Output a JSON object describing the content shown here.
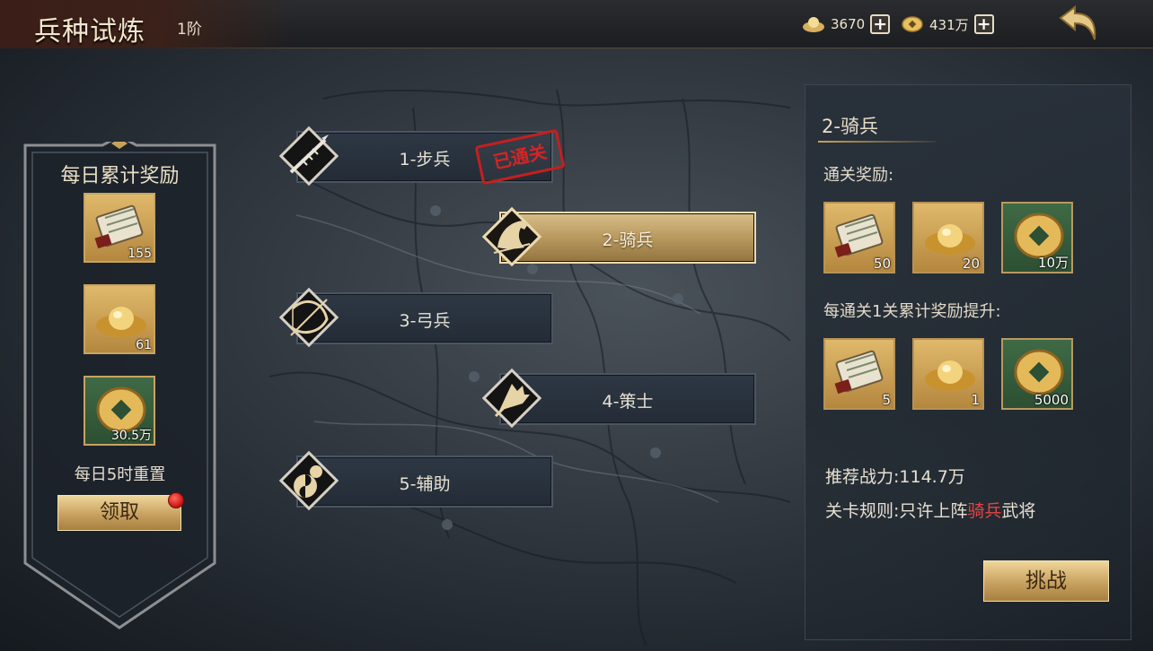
{
  "header": {
    "title": "兵种试炼",
    "rank": "1阶",
    "silver_amount": "3670",
    "gold_amount": "431万",
    "silver_icon": "silver-ingot-icon",
    "gold_icon": "gold-coin-icon",
    "add_label": "+"
  },
  "daily_panel": {
    "title": "每日累计奖励",
    "items": [
      {
        "icon": "scroll-icon",
        "count": "155"
      },
      {
        "icon": "gold-ingot-icon",
        "count": "61"
      },
      {
        "icon": "copper-coin-icon",
        "count": "30.5万"
      }
    ],
    "reset_text": "每日5时重置",
    "claim_label": "领取"
  },
  "stages": [
    {
      "label": "1-步兵",
      "icon": "spear-icon",
      "cleared": true
    },
    {
      "label": "2-骑兵",
      "icon": "horse-icon",
      "selected": true
    },
    {
      "label": "3-弓兵",
      "icon": "bow-icon"
    },
    {
      "label": "4-策士",
      "icon": "fan-icon"
    },
    {
      "label": "5-辅助",
      "icon": "gourd-icon"
    }
  ],
  "cleared_stamp": "已通关",
  "detail": {
    "title": "2-骑兵",
    "clear_reward_label": "通关奖励:",
    "clear_rewards": [
      {
        "icon": "scroll-icon",
        "count": "50"
      },
      {
        "icon": "gold-ingot-icon",
        "count": "20"
      },
      {
        "icon": "copper-coin-icon",
        "count": "10万"
      }
    ],
    "per_level_label": "每通关1关累计奖励提升:",
    "per_level_rewards": [
      {
        "icon": "scroll-icon",
        "count": "5"
      },
      {
        "icon": "gold-ingot-icon",
        "count": "1"
      },
      {
        "icon": "copper-coin-icon",
        "count": "5000"
      }
    ],
    "power_label": "推荐战力:",
    "power_value": "114.7万",
    "rule_prefix": "关卡规则:只许上阵",
    "rule_highlight": "骑兵",
    "rule_suffix": "武将",
    "challenge_label": "挑战"
  },
  "colors": {
    "accent_gold": "#c9a25a",
    "highlight_red": "#e64545",
    "stamp_red": "#c41f1f"
  }
}
